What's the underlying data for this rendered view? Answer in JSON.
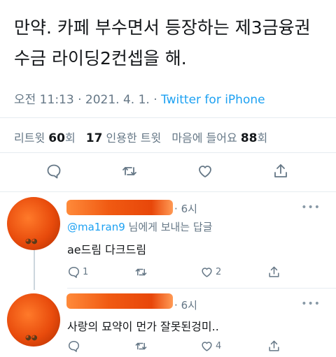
{
  "tweet": {
    "line1": "만약. 카페 부수면서 등장하는 제3금융권",
    "line2": "수금 라이딩2컨셉을 해.",
    "time": "오전 11:13",
    "date": "2021. 4. 1.",
    "sep1": "·",
    "sep2": "·",
    "source": "Twitter for iPhone"
  },
  "stats": {
    "retweets_label": "리트윗",
    "retweets_count": "60",
    "retweets_unit": "회",
    "quotes_count": "17",
    "quotes_label": "인용한 트윗",
    "likes_label": "마음에 들어요",
    "likes_count": "88",
    "likes_unit": "회"
  },
  "replies": [
    {
      "time": "6시",
      "sep": "·",
      "replying_mention": "@ma1ran9",
      "replying_suffix": " 님에게 보내는 답글",
      "text": "ae드림 다크드림",
      "reply_count": "1",
      "retweet_count": "",
      "like_count": "2",
      "more": "•••"
    },
    {
      "time": "6시",
      "sep": "·",
      "text": "사랑의 묘약이 먼가 잘못된겅미..",
      "reply_count": "",
      "retweet_count": "",
      "like_count": "4",
      "more": "•••"
    }
  ],
  "colors": {
    "accent": "#1da1f2",
    "muted": "#657786",
    "text": "#14171a",
    "divider": "#e6ecf0",
    "redaction": "#e8470a"
  },
  "icons": [
    "reply-icon",
    "retweet-icon",
    "like-icon",
    "share-icon",
    "more-icon"
  ]
}
